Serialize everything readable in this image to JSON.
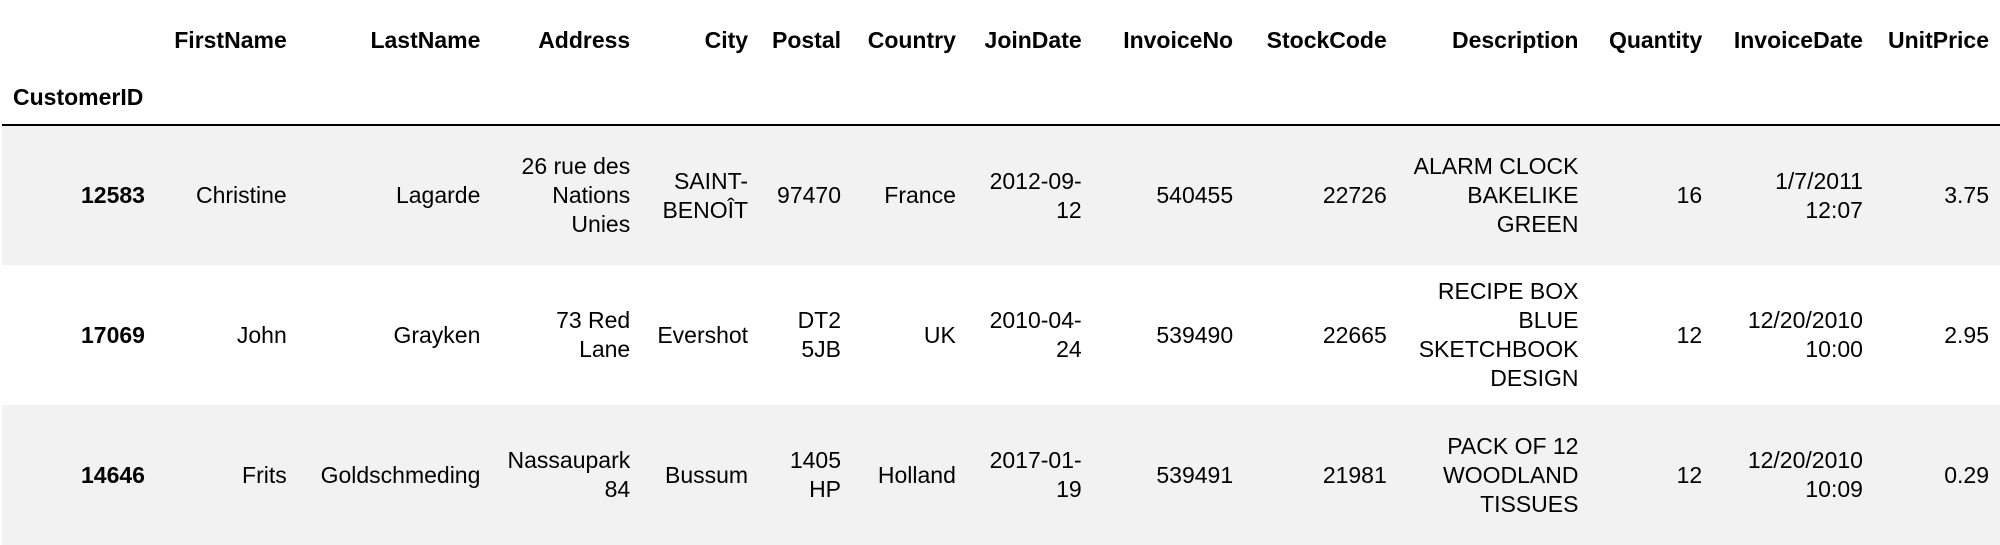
{
  "table": {
    "index_name": "CustomerID",
    "columns": [
      "FirstName",
      "LastName",
      "Address",
      "City",
      "Postal",
      "Country",
      "JoinDate",
      "InvoiceNo",
      "StockCode",
      "Description",
      "Quantity",
      "InvoiceDate",
      "UnitPrice"
    ],
    "rows": [
      {
        "CustomerID": "12583",
        "FirstName": "Christine",
        "LastName": "Lagarde",
        "Address": "26 rue des Nations Unies",
        "City": "SAINT-BENOÎT",
        "Postal": "97470",
        "Country": "France",
        "JoinDate": "2012-09-12",
        "InvoiceNo": "540455",
        "StockCode": "22726",
        "Description": "ALARM CLOCK BAKELIKE GREEN",
        "Quantity": "16",
        "InvoiceDate": "1/7/2011 12:07",
        "UnitPrice": "3.75"
      },
      {
        "CustomerID": "17069",
        "FirstName": "John",
        "LastName": "Grayken",
        "Address": "73 Red Lane",
        "City": "Evershot",
        "Postal": "DT2 5JB",
        "Country": "UK",
        "JoinDate": "2010-04-24",
        "InvoiceNo": "539490",
        "StockCode": "22665",
        "Description": "RECIPE BOX BLUE SKETCHBOOK DESIGN",
        "Quantity": "12",
        "InvoiceDate": "12/20/2010 10:00",
        "UnitPrice": "2.95"
      },
      {
        "CustomerID": "14646",
        "FirstName": "Frits",
        "LastName": "Goldschmeding",
        "Address": "Nassaupark 84",
        "City": "Bussum",
        "Postal": "1405 HP",
        "Country": "Holland",
        "JoinDate": "2017-01-19",
        "InvoiceNo": "539491",
        "StockCode": "21981",
        "Description": "PACK OF 12 WOODLAND TISSUES",
        "Quantity": "12",
        "InvoiceDate": "12/20/2010 10:09",
        "UnitPrice": "0.29"
      }
    ]
  }
}
